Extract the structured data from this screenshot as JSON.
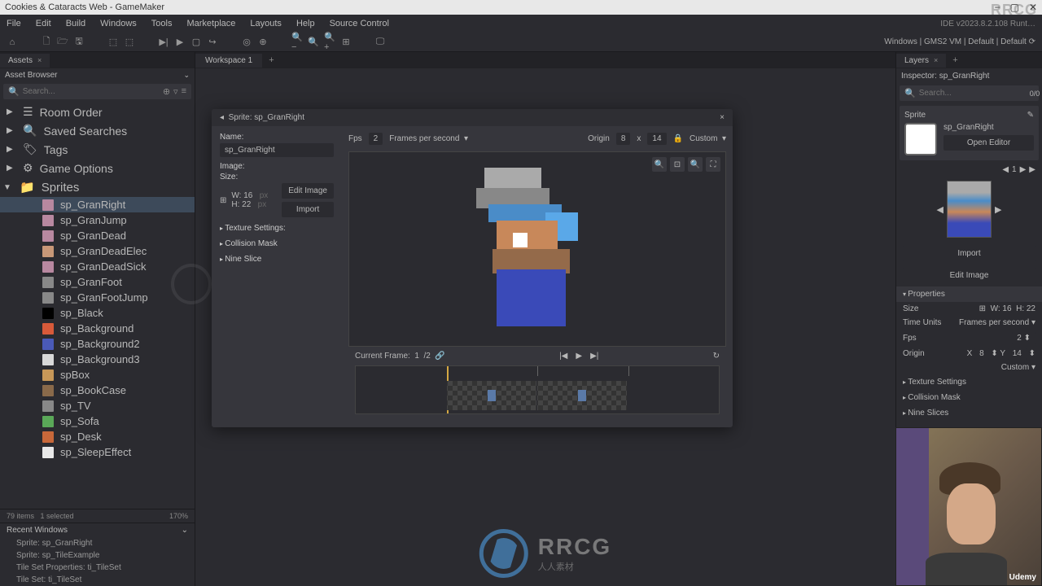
{
  "titlebar": {
    "title": "Cookies & Cataracts Web - GameMaker"
  },
  "menu": {
    "file": "File",
    "edit": "Edit",
    "build": "Build",
    "windows": "Windows",
    "tools": "Tools",
    "marketplace": "Marketplace",
    "layouts": "Layouts",
    "help": "Help",
    "source": "Source Control",
    "ide": "IDE v2023.8.2.108  Runt…"
  },
  "toolbar": {
    "runtime": "Windows | GMS2 VM | Default | Default"
  },
  "assets": {
    "tab": "Assets",
    "browser": "Asset Browser",
    "search_ph": "Search...",
    "sections": {
      "room_order": "Room Order",
      "saved": "Saved Searches",
      "tags": "Tags",
      "game_options": "Game Options",
      "sprites": "Sprites"
    },
    "sprites": [
      {
        "name": "sp_GranRight",
        "selected": true,
        "color": "#b888a0"
      },
      {
        "name": "sp_GranJump",
        "color": "#b888a0"
      },
      {
        "name": "sp_GranDead",
        "color": "#b888a0"
      },
      {
        "name": "sp_GranDeadElec",
        "color": "#c89878"
      },
      {
        "name": "sp_GranDeadSick",
        "color": "#b888a0"
      },
      {
        "name": "sp_GranFoot",
        "color": "#888"
      },
      {
        "name": "sp_GranFootJump",
        "color": "#888"
      },
      {
        "name": "sp_Black",
        "color": "#000"
      },
      {
        "name": "sp_Background",
        "color": "#d85a3a"
      },
      {
        "name": "sp_Background2",
        "color": "#4a5ab8"
      },
      {
        "name": "sp_Background3",
        "color": "#d8d8d8"
      },
      {
        "name": "spBox",
        "color": "#c89858"
      },
      {
        "name": "sp_BookCase",
        "color": "#8a6a4a"
      },
      {
        "name": "sp_TV",
        "color": "#888"
      },
      {
        "name": "sp_Sofa",
        "color": "#5aa858"
      },
      {
        "name": "sp_Desk",
        "color": "#c8683a"
      },
      {
        "name": "sp_SleepEffect",
        "color": "#e8e8e8"
      }
    ],
    "status": {
      "items": "79 items",
      "selected": "1 selected",
      "zoom": "170%"
    },
    "recent": {
      "header": "Recent Windows",
      "items": [
        "Sprite: sp_GranRight",
        "Sprite: sp_TileExample",
        "Tile Set Properties: ti_TileSet",
        "Tile Set: ti_TileSet"
      ]
    }
  },
  "workspace": {
    "tab": "Workspace 1"
  },
  "sprite_editor": {
    "title": "Sprite: sp_GranRight",
    "name_label": "Name:",
    "name": "sp_GranRight",
    "image_label": "Image:",
    "size_label": "Size:",
    "w_label": "W:",
    "w": "16",
    "h_label": "H:",
    "h": "22",
    "px": "px",
    "edit_image": "Edit Image",
    "import": "Import",
    "texture": "Texture Settings:",
    "collision": "Collision Mask",
    "nineslice": "Nine Slice",
    "fps_label": "Fps",
    "fps": "2",
    "fps_unit": "Frames per second",
    "origin_label": "Origin",
    "origin_x": "8",
    "origin_y_label": "x",
    "origin_y": "14",
    "origin_mode": "Custom",
    "current_frame_label": "Current Frame:",
    "current_frame": "1",
    "total_frames": "/2"
  },
  "inspector": {
    "layers_tab": "Layers",
    "header": "Inspector: sp_GranRight",
    "search_ph": "Search...",
    "search_count": "0/0",
    "sprite_label": "Sprite",
    "sprite_name": "sp_GranRight",
    "open_editor": "Open Editor",
    "import": "Import",
    "edit_image": "Edit Image",
    "frame_nav": "1",
    "properties": "Properties",
    "size_label": "Size",
    "size_w": "W: 16",
    "size_h": "H: 22",
    "time_units": "Time Units",
    "time_units_val": "Frames per second",
    "fps_label": "Fps",
    "fps": "2",
    "origin_label": "Origin",
    "origin_x_label": "X",
    "origin_x": "8",
    "origin_y_label": "Y",
    "origin_y": "14",
    "origin_mode": "Custom",
    "texture": "Texture Settings",
    "collision": "Collision Mask",
    "nineslices": "Nine Slices"
  },
  "watermark": {
    "text": "RRCG",
    "sub": "人人素材",
    "udemy": "Udemy"
  }
}
